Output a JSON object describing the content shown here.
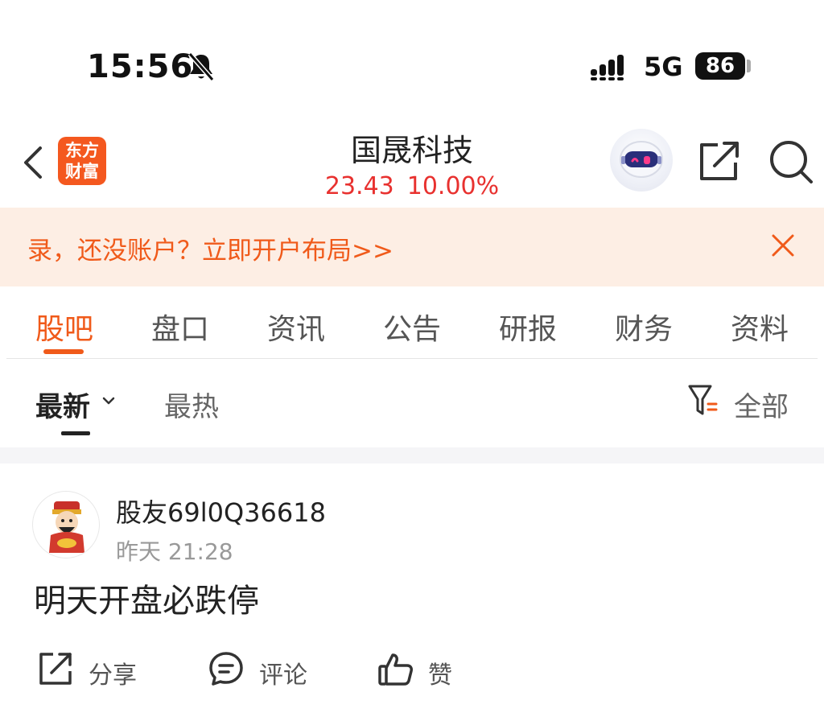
{
  "status_bar": {
    "time": "15:56",
    "network": "5G",
    "battery": "86"
  },
  "header": {
    "logo_line1": "东方",
    "logo_line2": "财富",
    "stock_name": "国晟科技",
    "price": "23.43",
    "change_pct": "10.00%"
  },
  "banner": {
    "text": "录，还没账户？立即开户布局>>"
  },
  "tabs": [
    {
      "label": "股吧",
      "active": true
    },
    {
      "label": "盘口"
    },
    {
      "label": "资讯"
    },
    {
      "label": "公告"
    },
    {
      "label": "研报"
    },
    {
      "label": "财务"
    },
    {
      "label": "资料"
    }
  ],
  "filter": {
    "latest": "最新",
    "hot": "最热",
    "all": "全部"
  },
  "post": {
    "username": "股友69l0Q36618",
    "timestamp": "昨天 21:28",
    "content": "明天开盘必跌停",
    "share_label": "分享",
    "comment_label": "评论",
    "like_label": "赞"
  },
  "colors": {
    "accent": "#f05a1a",
    "price_red": "#e8312f",
    "banner_bg": "#fdeee4"
  }
}
